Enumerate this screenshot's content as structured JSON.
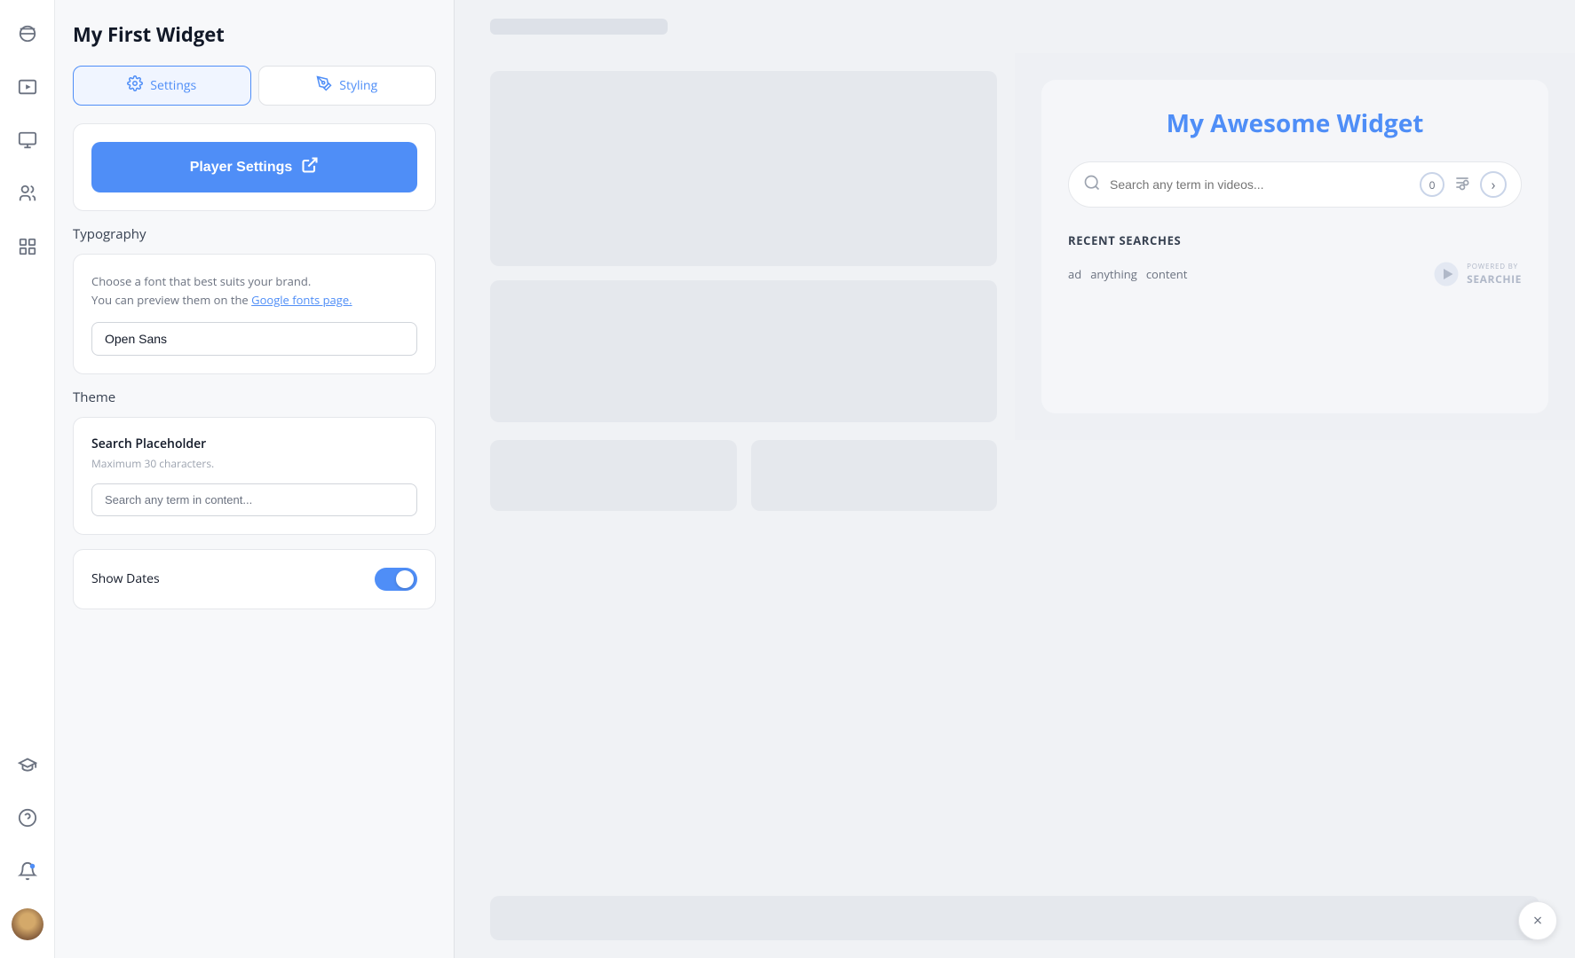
{
  "sidebar": {
    "icons": [
      {
        "name": "menu-icon",
        "label": "Menu"
      },
      {
        "name": "video-icon",
        "label": "Video"
      },
      {
        "name": "monitor-icon",
        "label": "Monitor"
      },
      {
        "name": "users-icon",
        "label": "Users"
      },
      {
        "name": "grid-icon",
        "label": "Grid"
      }
    ],
    "bottom_icons": [
      {
        "name": "graduation-icon",
        "label": "Learn"
      },
      {
        "name": "question-icon",
        "label": "Help"
      },
      {
        "name": "bell-icon",
        "label": "Notifications"
      }
    ]
  },
  "panel": {
    "title": "My First Widget",
    "tabs": [
      {
        "label": "Settings",
        "icon": "gear-icon",
        "active": true
      },
      {
        "label": "Styling",
        "icon": "brush-icon",
        "active": false
      }
    ],
    "player_settings_button": "Player Settings",
    "typography": {
      "section_label": "Typography",
      "description_line1": "Choose a font that best suits your brand.",
      "description_line2": "You can preview them on the",
      "link_text": "Google fonts page.",
      "font_value": "Open Sans"
    },
    "theme": {
      "section_label": "Theme",
      "search_placeholder": {
        "title": "Search Placeholder",
        "description": "Maximum 30 characters.",
        "value": "Search any term in content..."
      },
      "show_dates": {
        "label": "Show Dates",
        "enabled": true
      }
    }
  },
  "widget_preview": {
    "title": "My Awesome Widget",
    "search_placeholder": "Search any term in videos...",
    "badge_count": "0",
    "recent_searches": {
      "label": "RECENT SEARCHES",
      "tags": [
        "ad",
        "anything",
        "content"
      ]
    },
    "searchie_logo": {
      "prefix": "POWERED BY",
      "brand": "SEARCHIE"
    }
  },
  "close_button_label": "×",
  "colors": {
    "primary": "#4f8ef7",
    "toggle_on": "#4f8ef7"
  }
}
